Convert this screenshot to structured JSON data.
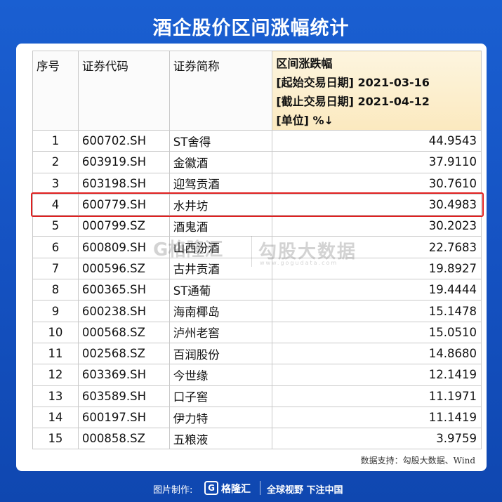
{
  "title": "酒企股价区间涨幅统计",
  "table": {
    "headers": [
      "序号",
      "证券代码",
      "证券简称"
    ],
    "range_header": {
      "line1": "区间涨跌幅",
      "line2": "[起始交易日期] 2021-03-16",
      "line3": "[截止交易日期] 2021-04-12",
      "line4": "[单位] %↓"
    },
    "rows": [
      [
        "1",
        "600702.SH",
        "ST舍得",
        "44.9543"
      ],
      [
        "2",
        "603919.SH",
        "金徽酒",
        "37.9110"
      ],
      [
        "3",
        "603198.SH",
        "迎驾贡酒",
        "30.7610"
      ],
      [
        "4",
        "600779.SH",
        "水井坊",
        "30.4983"
      ],
      [
        "5",
        "000799.SZ",
        "酒鬼酒",
        "30.2023"
      ],
      [
        "6",
        "600809.SH",
        "山西汾酒",
        "22.7683"
      ],
      [
        "7",
        "000596.SZ",
        "古井贡酒",
        "19.8927"
      ],
      [
        "8",
        "600365.SH",
        "ST通葡",
        "19.4444"
      ],
      [
        "9",
        "600238.SH",
        "海南椰岛",
        "15.1478"
      ],
      [
        "10",
        "000568.SZ",
        "泸州老窖",
        "15.0510"
      ],
      [
        "11",
        "002568.SZ",
        "百润股份",
        "14.8680"
      ],
      [
        "12",
        "603369.SH",
        "今世缘",
        "12.1419"
      ],
      [
        "13",
        "603589.SH",
        "口子窖",
        "11.1971"
      ],
      [
        "14",
        "600197.SH",
        "伊力特",
        "11.1419"
      ],
      [
        "15",
        "000858.SZ",
        "五粮液",
        "3.9759"
      ]
    ],
    "highlighted_row": 4
  },
  "watermark": {
    "logo": "G格隆汇",
    "brand": "勾股大数据",
    "url": "www.gogudata.com"
  },
  "source": "数据支持：勾股大数据、Wind",
  "footer": {
    "label": "图片制作:",
    "logo_letter": "G",
    "brand": "格隆汇",
    "slogan": "全球视野 下注中国"
  },
  "colors": {
    "background": "#1552c2",
    "highlight_border": "#e02020",
    "header_highlight": "#fbe9bf"
  }
}
